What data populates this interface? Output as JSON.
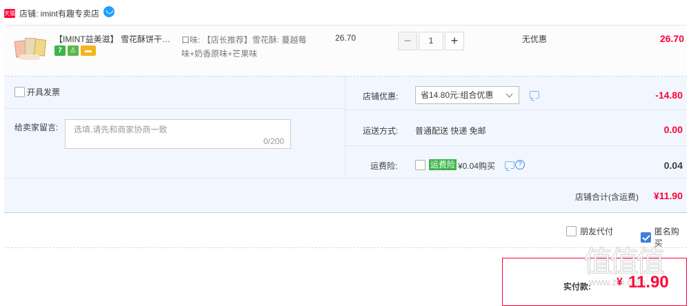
{
  "shop": {
    "badge": "天猫",
    "name": "店铺: imint有趣专卖店"
  },
  "item": {
    "title": "【IMINT益美滋】 雪花酥饼干…",
    "badges": [
      "7",
      "",
      ""
    ],
    "sku": "口味: 【店长推荐】雪花酥: 蔓越莓味+奶香原味+芒果味",
    "unit_price": "26.70",
    "quantity": "1",
    "qty_minus": "−",
    "qty_plus": "+",
    "discount": "无优惠",
    "total": "26.70"
  },
  "order": {
    "invoice_label": "开具发票",
    "message_label": "给卖家留言:",
    "message_placeholder": "选填,请先和商家协商一致",
    "message_count": "0/200",
    "shop_discount_label": "店铺优惠:",
    "shop_discount_select": "省14.80元:组合优惠",
    "shop_discount_value": "-14.80",
    "shipping_label": "运送方式:",
    "shipping_method": "普通配送 快递 免邮",
    "shipping_value": "0.00",
    "insurance_label": "运费险:",
    "insurance_tag": "运费险",
    "insurance_price": "¥0.04购买",
    "insurance_value": "0.04",
    "subtotal_label": "店铺合计(含运费)",
    "subtotal_value": "¥11.90"
  },
  "options": {
    "friend_pay": "朋友代付",
    "anonymous": "匿名购买"
  },
  "payment": {
    "label": "实付款:",
    "currency": "¥",
    "amount": "11.90"
  },
  "watermark": {
    "glyphs": "值值值",
    "url": "www.zhi.com"
  },
  "colors": {
    "accent_red": "#ff0036",
    "panel_bg": "#f2f7ff",
    "tag_green": "#3cb44a"
  }
}
